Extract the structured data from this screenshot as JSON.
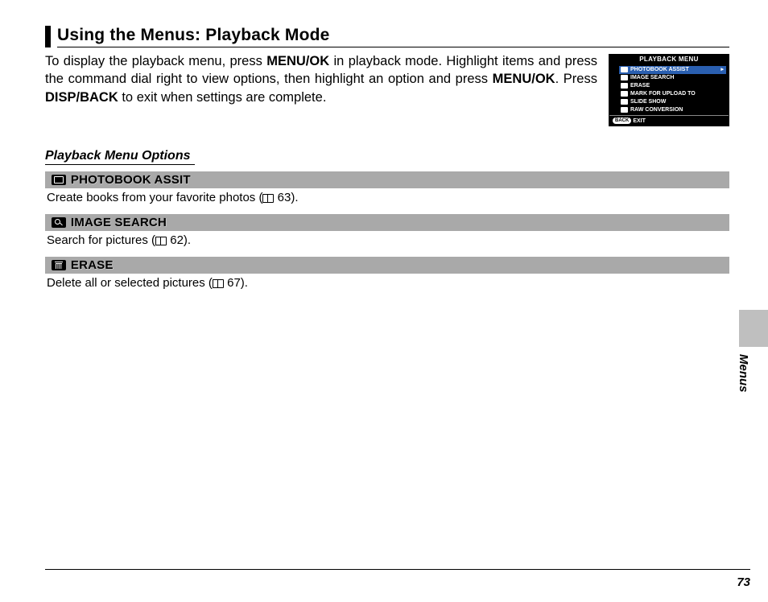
{
  "headline": "Using the Menus: Playback Mode",
  "intro": {
    "seg1": "To display the playback menu, press ",
    "k1": "MENU/OK",
    "seg2": " in playback mode. Highlight items and press the command dial right to view options, then highlight an option and press ",
    "k2": "MENU/OK",
    "seg3": ". Press ",
    "k3": "DISP/BACK",
    "seg4": " to exit when settings are complete."
  },
  "lcd": {
    "title": "PLAYBACK MENU",
    "items": [
      "PHOTOBOOK ASSIST",
      "IMAGE SEARCH",
      "ERASE",
      "MARK FOR UPLOAD TO",
      "SLIDE SHOW",
      "RAW CONVERSION"
    ],
    "back_label": "BACK",
    "exit_label": "EXIT"
  },
  "subhead": "Playback Menu Options",
  "options": [
    {
      "icon": "book",
      "label": "PHOTOBOOK ASSIT",
      "desc_pre": "Create books from your favorite photos (",
      "desc_ref": " 63",
      "desc_post": ")."
    },
    {
      "icon": "search",
      "label": "IMAGE SEARCH",
      "desc_pre": "Search for pictures (",
      "desc_ref": " 62",
      "desc_post": ")."
    },
    {
      "icon": "trash",
      "label": "ERASE",
      "desc_pre": "Delete all or selected pictures (",
      "desc_ref": " 67",
      "desc_post": ")."
    }
  ],
  "side_label": "Menus",
  "page_number": "73"
}
